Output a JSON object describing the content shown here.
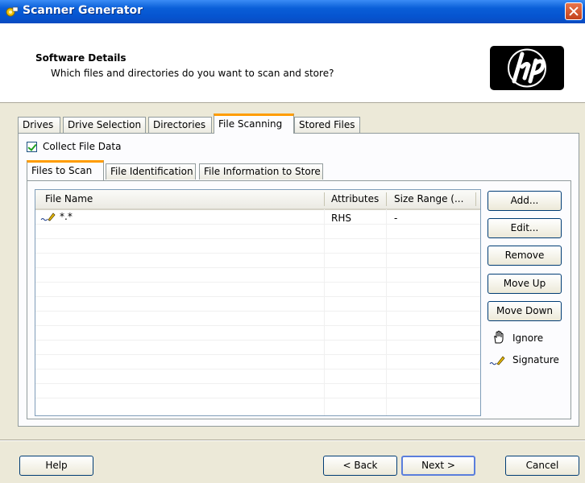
{
  "window": {
    "title": "Scanner Generator"
  },
  "header": {
    "title": "Software Details",
    "subtitle": "Which files and directories do you want to scan and store?"
  },
  "tabs": [
    {
      "label": "Drives"
    },
    {
      "label": "Drive Selection"
    },
    {
      "label": "Directories"
    },
    {
      "label": "File Scanning",
      "active": true
    },
    {
      "label": "Stored Files"
    }
  ],
  "collect": {
    "label": "Collect File Data",
    "checked": true
  },
  "subtabs": [
    {
      "label": "Files to Scan",
      "active": true
    },
    {
      "label": "File Identification"
    },
    {
      "label": "File Information to Store"
    }
  ],
  "table": {
    "columns": [
      "File Name",
      "Attributes",
      "Size Range (..."
    ],
    "rows": [
      {
        "icon": "signature-icon",
        "name": "*.*",
        "attributes": "RHS",
        "size_range": "-"
      }
    ]
  },
  "side_buttons": {
    "add": "Add...",
    "edit": "Edit...",
    "remove": "Remove",
    "move_up": "Move Up",
    "move_down": "Move Down"
  },
  "legend": {
    "ignore": "Ignore",
    "signature": "Signature"
  },
  "footer": {
    "help": "Help",
    "back": "< Back",
    "next": "Next >",
    "cancel": "Cancel"
  },
  "colors": {
    "accent_tab": "#ff9c00",
    "title_bar": "#0a5fd8",
    "check": "#21a121"
  }
}
